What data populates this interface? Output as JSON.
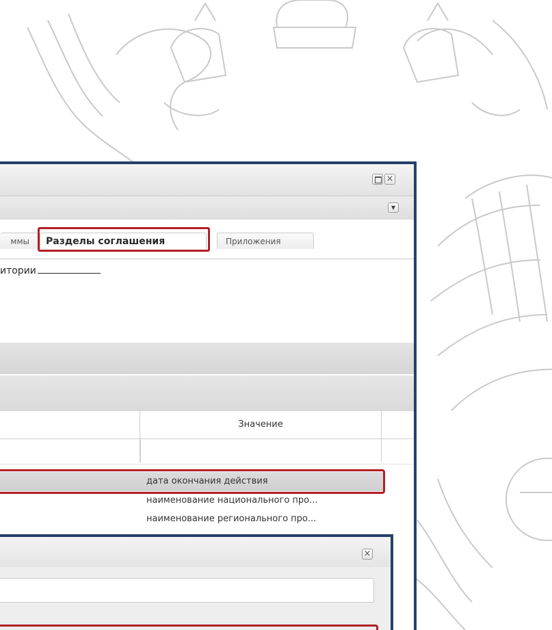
{
  "window": {
    "tabs": [
      {
        "label": "ммы"
      },
      {
        "label": "Разделы соглашения"
      },
      {
        "label": "Приложения"
      }
    ],
    "heading": "итории",
    "grid": {
      "value_header": "Значение",
      "rows": [
        {
          "value": "дата окончания действия"
        },
        {
          "value": "наименование национального про..."
        },
        {
          "value": "наименование регионального про..."
        }
      ]
    },
    "controls": {
      "maximize_icon": "maximize-icon",
      "close_icon": "close-icon",
      "menu_icon": "dropdown-arrow-icon"
    }
  },
  "colors": {
    "window_border": "#26406a",
    "highlight": "#b21f26",
    "selected_row": "#d4d4d4"
  }
}
